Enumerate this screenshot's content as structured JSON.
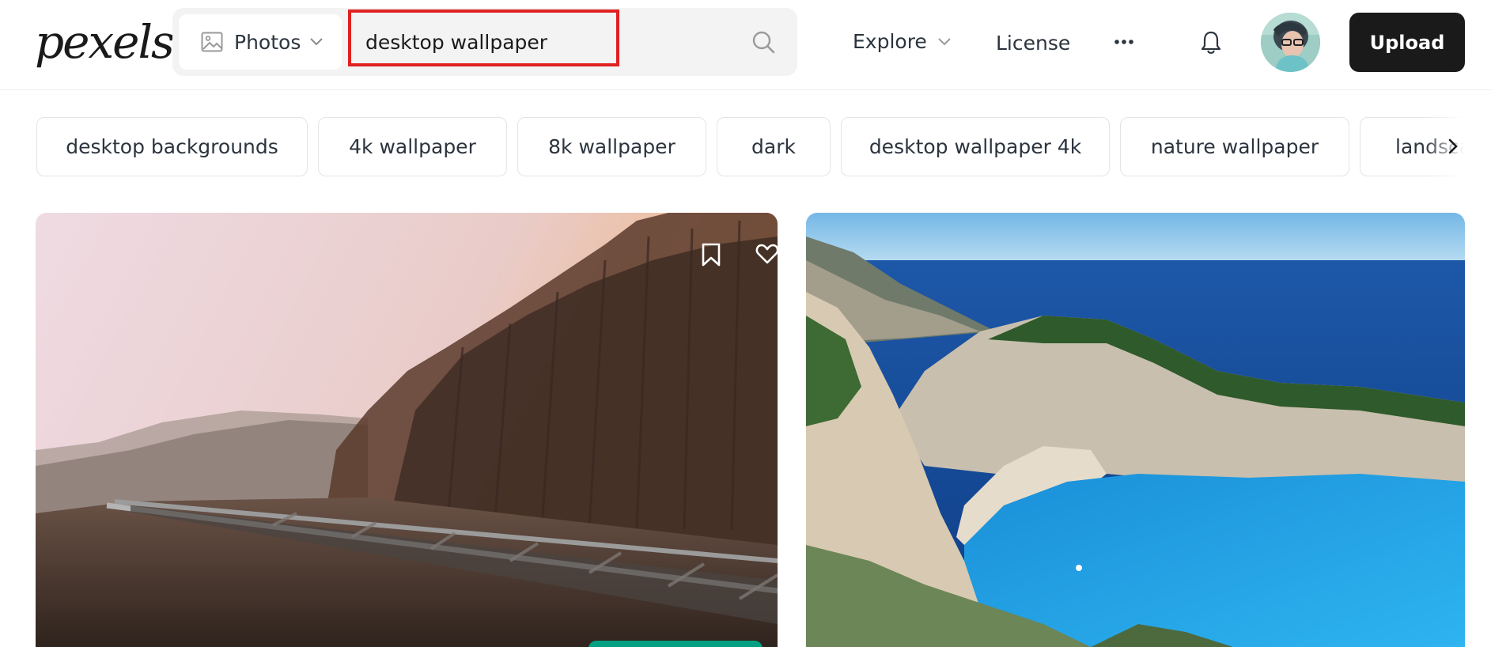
{
  "header": {
    "logo_text": "pexels",
    "search": {
      "type_label": "Photos",
      "query": "desktop wallpaper"
    },
    "nav": {
      "explore_label": "Explore",
      "license_label": "License"
    },
    "upload_label": "Upload"
  },
  "chips": [
    {
      "label": "desktop backgrounds"
    },
    {
      "label": "4k wallpaper"
    },
    {
      "label": "8k wallpaper"
    },
    {
      "label": "dark"
    },
    {
      "label": "desktop wallpaper 4k"
    },
    {
      "label": "nature wallpaper"
    },
    {
      "label": "landscape"
    }
  ],
  "icons": {
    "type": "image-icon",
    "type_dropdown": "chevron-down-icon",
    "search": "search-icon",
    "explore_dropdown": "chevron-down-icon",
    "more": "more-dots-icon",
    "notifications": "bell-icon",
    "chips_next": "chevron-right-icon",
    "bookmark": "bookmark-icon",
    "like": "heart-icon"
  },
  "colors": {
    "upload_bg": "#1a1a1a",
    "highlight": "#e02020",
    "download_green": "#05a081"
  }
}
